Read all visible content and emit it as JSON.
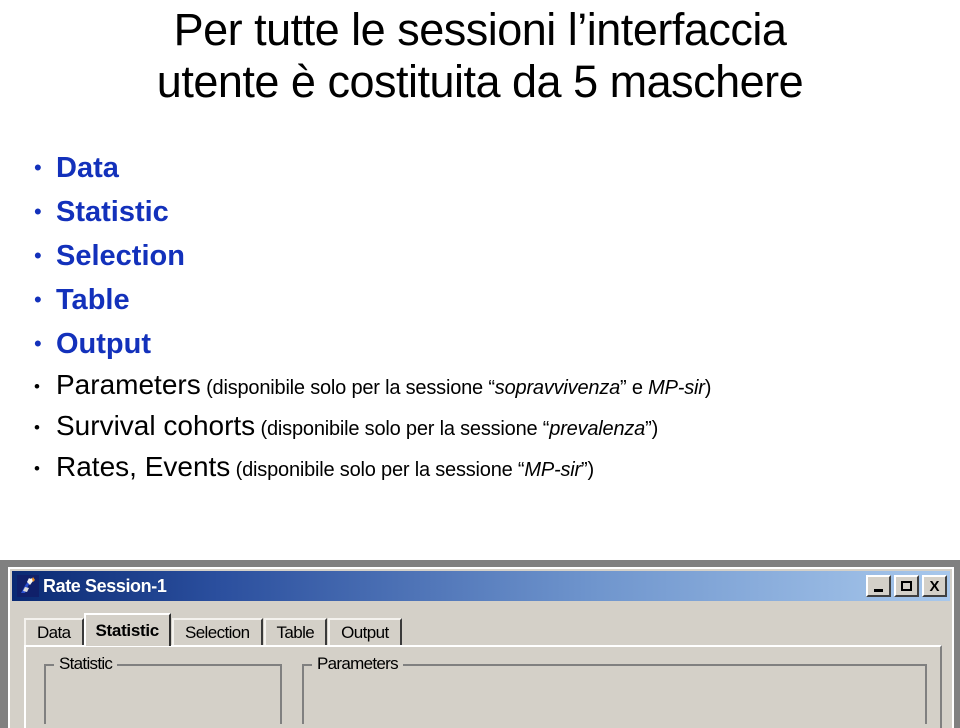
{
  "slide": {
    "title_line1": "Per tutte le sessioni l’interfaccia",
    "title_line2": "utente è costituita da 5 maschere",
    "bullet_char": "•",
    "accent_blue": "#1331bb",
    "bullets_blue": [
      {
        "label": "Data"
      },
      {
        "label": "Statistic"
      },
      {
        "label": "Selection"
      },
      {
        "label": "Table"
      },
      {
        "label": "Output"
      }
    ],
    "bullets_black": [
      {
        "label": "Parameters",
        "note_open": " (disponibile solo per la sessione “",
        "note_em1": "sopravvivenza",
        "note_mid": "” e ",
        "note_em2": "MP-sir",
        "note_close": ")"
      },
      {
        "label": "Survival cohorts",
        "note_open": " (disponibile solo per la sessione “",
        "note_em1": "prevalenza",
        "note_mid": "”",
        "note_em2": "",
        "note_close": ")"
      },
      {
        "label": "Rates, Events",
        "note_open": " (disponibile solo per la sessione “",
        "note_em1": "MP-sir",
        "note_mid": "”",
        "note_em2": "",
        "note_close": ")"
      }
    ]
  },
  "window": {
    "title": "Rate Session-1",
    "icon_name": "app-icon",
    "buttons": {
      "minimize": "_",
      "maximize": "□",
      "close": "X"
    },
    "tabs": [
      {
        "label": "Data",
        "active": false
      },
      {
        "label": "Statistic",
        "active": true
      },
      {
        "label": "Selection",
        "active": false
      },
      {
        "label": "Table",
        "active": false
      },
      {
        "label": "Output",
        "active": false
      }
    ],
    "groupboxes": [
      {
        "label": "Statistic"
      },
      {
        "label": "Parameters"
      }
    ]
  }
}
